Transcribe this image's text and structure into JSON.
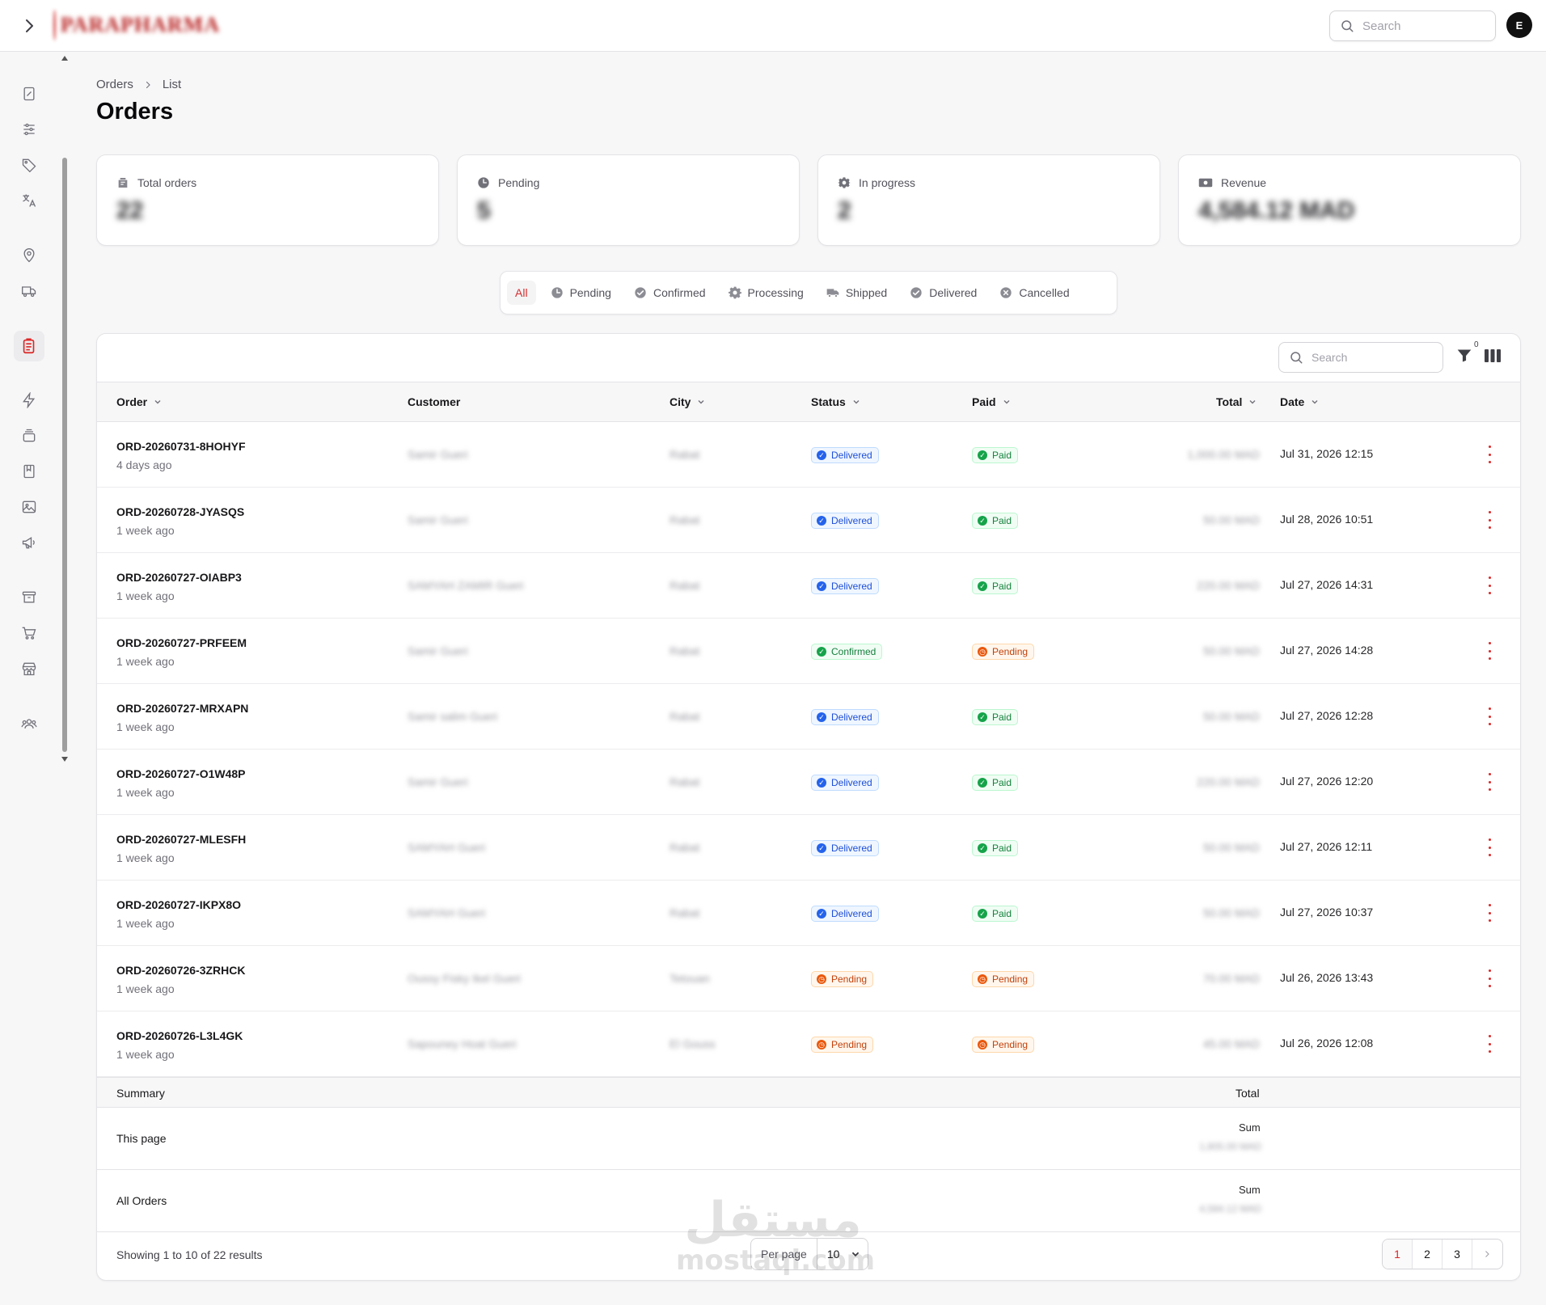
{
  "header": {
    "search_placeholder": "Search",
    "avatar_initial": "E",
    "logo_text": "PARAPHARMA"
  },
  "breadcrumb": [
    "Orders",
    "List"
  ],
  "page_title": "Orders",
  "stats": [
    {
      "label": "Total orders",
      "value": "22",
      "icon": "orders-icon"
    },
    {
      "label": "Pending",
      "value": "5",
      "icon": "clock-icon"
    },
    {
      "label": "In progress",
      "value": "2",
      "icon": "gear-icon"
    },
    {
      "label": "Revenue",
      "value": "4,584.12 MAD",
      "icon": "cash-icon"
    }
  ],
  "tabs": [
    {
      "label": "All",
      "active": true
    },
    {
      "label": "Pending",
      "icon": "clock-icon"
    },
    {
      "label": "Confirmed",
      "icon": "check-circle-icon"
    },
    {
      "label": "Processing",
      "icon": "gear-icon"
    },
    {
      "label": "Shipped",
      "icon": "truck-icon"
    },
    {
      "label": "Delivered",
      "icon": "check-circle-icon"
    },
    {
      "label": "Cancelled",
      "icon": "x-circle-icon"
    }
  ],
  "table": {
    "search_placeholder": "Search",
    "filter_count": "0",
    "columns": [
      "Order",
      "Customer",
      "City",
      "Status",
      "Paid",
      "Total",
      "Date"
    ],
    "rows": [
      {
        "order": "ORD-20260731-8HOHYF",
        "ago": "4 days ago",
        "customer": "Samir Gueri",
        "city": "Rabat",
        "status": "Delivered",
        "status_color": "blue",
        "paid": "Paid",
        "paid_color": "green",
        "total": "1,000.00 MAD",
        "date": "Jul 31, 2026 12:15"
      },
      {
        "order": "ORD-20260728-JYASQS",
        "ago": "1 week ago",
        "customer": "Samir Gueri",
        "city": "Rabat",
        "status": "Delivered",
        "status_color": "blue",
        "paid": "Paid",
        "paid_color": "green",
        "total": "50.00 MAD",
        "date": "Jul 28, 2026 10:51"
      },
      {
        "order": "ORD-20260727-OIABP3",
        "ago": "1 week ago",
        "customer": "SAMYAH ZAMIR Gueri",
        "city": "Rabat",
        "status": "Delivered",
        "status_color": "blue",
        "paid": "Paid",
        "paid_color": "green",
        "total": "220.00 MAD",
        "date": "Jul 27, 2026 14:31"
      },
      {
        "order": "ORD-20260727-PRFEEM",
        "ago": "1 week ago",
        "customer": "Samir Gueri",
        "city": "Rabat",
        "status": "Confirmed",
        "status_color": "green",
        "paid": "Pending",
        "paid_color": "orange",
        "total": "50.00 MAD",
        "date": "Jul 27, 2026 14:28"
      },
      {
        "order": "ORD-20260727-MRXAPN",
        "ago": "1 week ago",
        "customer": "Samir salim Gueri",
        "city": "Rabat",
        "status": "Delivered",
        "status_color": "blue",
        "paid": "Paid",
        "paid_color": "green",
        "total": "50.00 MAD",
        "date": "Jul 27, 2026 12:28"
      },
      {
        "order": "ORD-20260727-O1W48P",
        "ago": "1 week ago",
        "customer": "Samir Gueri",
        "city": "Rabat",
        "status": "Delivered",
        "status_color": "blue",
        "paid": "Paid",
        "paid_color": "green",
        "total": "220.00 MAD",
        "date": "Jul 27, 2026 12:20"
      },
      {
        "order": "ORD-20260727-MLESFH",
        "ago": "1 week ago",
        "customer": "SAMYAH Gueri",
        "city": "Rabat",
        "status": "Delivered",
        "status_color": "blue",
        "paid": "Paid",
        "paid_color": "green",
        "total": "50.00 MAD",
        "date": "Jul 27, 2026 12:11"
      },
      {
        "order": "ORD-20260727-IKPX8O",
        "ago": "1 week ago",
        "customer": "SAMYAH Gueri",
        "city": "Rabat",
        "status": "Delivered",
        "status_color": "blue",
        "paid": "Paid",
        "paid_color": "green",
        "total": "50.00 MAD",
        "date": "Jul 27, 2026 10:37"
      },
      {
        "order": "ORD-20260726-3ZRHCK",
        "ago": "1 week ago",
        "customer": "Oussy Fisky Ikel Gueri",
        "city": "Tetouan",
        "status": "Pending",
        "status_color": "orange",
        "paid": "Pending",
        "paid_color": "orange",
        "total": "70.00 MAD",
        "date": "Jul 26, 2026 13:43"
      },
      {
        "order": "ORD-20260726-L3L4GK",
        "ago": "1 week ago",
        "customer": "Sapouney Hoat Gueri",
        "city": "El Gouss",
        "status": "Pending",
        "status_color": "orange",
        "paid": "Pending",
        "paid_color": "orange",
        "total": "45.00 MAD",
        "date": "Jul 26, 2026 12:08"
      }
    ],
    "summary": {
      "label": "Summary",
      "total_label": "Total",
      "this_page": {
        "label": "This page",
        "sum_label": "Sum",
        "value": "1,805.00 MAD"
      },
      "all_orders": {
        "label": "All Orders",
        "sum_label": "Sum",
        "value": "4,584.12 MAD"
      }
    },
    "footer": {
      "showing": "Showing 1 to 10 of 22 results",
      "per_page_label": "Per page",
      "per_page_value": "10",
      "pages": [
        "1",
        "2",
        "3"
      ],
      "current_page": "1"
    }
  },
  "watermark": {
    "arabic": "مستقل",
    "latin": "mostaql.com"
  },
  "colors": {
    "accent": "#dc2626",
    "blue": "#2563eb",
    "green": "#16a34a",
    "orange": "#ea580c"
  }
}
